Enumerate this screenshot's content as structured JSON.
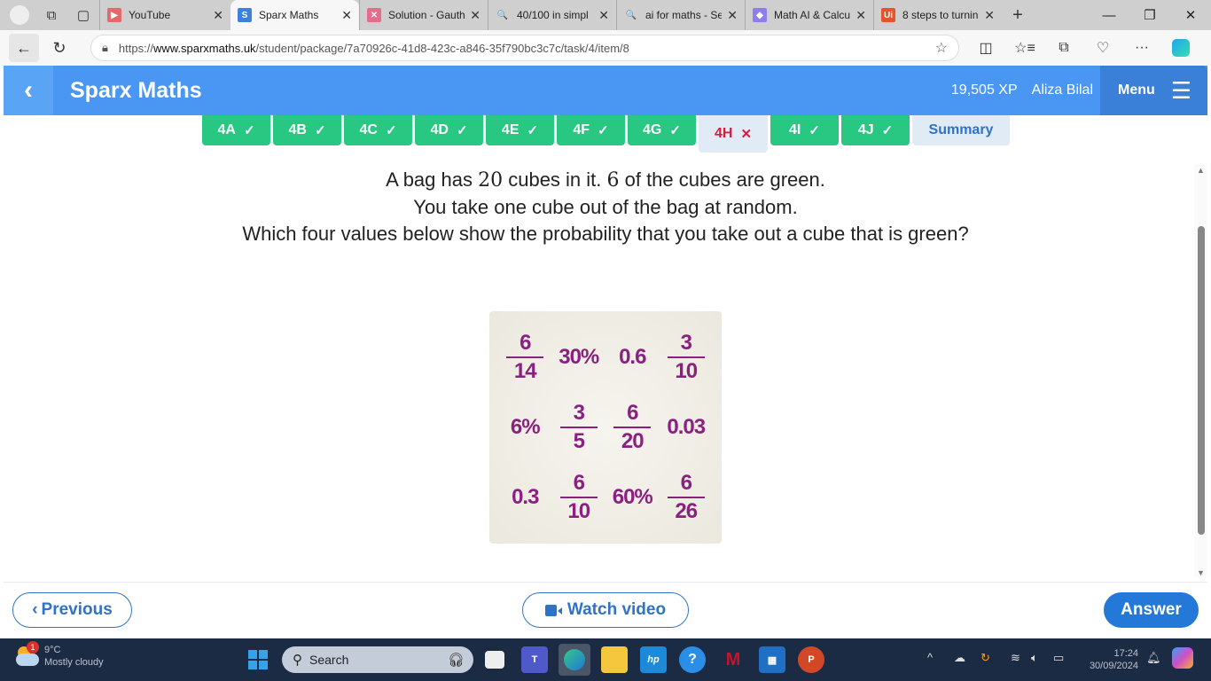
{
  "browser": {
    "tabs": [
      {
        "title": "YouTube",
        "icon": "youtube-icon",
        "color": "#e26a6a",
        "glyph": "▶"
      },
      {
        "title": "Sparx Maths",
        "icon": "sparx-icon",
        "color": "#3b82e0",
        "glyph": "S",
        "active": true
      },
      {
        "title": "Solution - Gauth",
        "icon": "gauth-icon",
        "color": "#e76b8a",
        "glyph": "✕"
      },
      {
        "title": "40/100 in simpl",
        "icon": "search-icon",
        "color": "transparent",
        "glyph": "🔍"
      },
      {
        "title": "ai for maths - Se",
        "icon": "search-icon",
        "color": "transparent",
        "glyph": "🔍"
      },
      {
        "title": "Math AI & Calcu",
        "icon": "mathai-icon",
        "color": "#8f7cf0",
        "glyph": "◆"
      },
      {
        "title": "8 steps to turnin",
        "icon": "uipath-icon",
        "color": "#e8542a",
        "glyph": "Ui"
      }
    ],
    "url_prefix": "https://",
    "url_domain": "www.sparxmaths.uk",
    "url_path": "/student/package/7a70926c-41d8-423c-a846-35f790bc3c7c/task/4/item/8"
  },
  "header": {
    "brand": "Sparx Maths",
    "xp": "19,505 XP",
    "user": "Aliza Bilal",
    "menu": "Menu"
  },
  "tasks": [
    {
      "label": "4A",
      "status": "✓"
    },
    {
      "label": "4B",
      "status": "✓"
    },
    {
      "label": "4C",
      "status": "✓"
    },
    {
      "label": "4D",
      "status": "✓"
    },
    {
      "label": "4E",
      "status": "✓"
    },
    {
      "label": "4F",
      "status": "✓"
    },
    {
      "label": "4G",
      "status": "✓"
    },
    {
      "label": "4H",
      "status": "✕"
    },
    {
      "label": "4I",
      "status": "✓"
    },
    {
      "label": "4J",
      "status": "✓"
    }
  ],
  "summary_label": "Summary",
  "question": {
    "l1a": "A bag has ",
    "n1": "20",
    "l1b": " cubes in it. ",
    "n2": "6",
    "l1c": " of the cubes are green.",
    "line2": "You take one cube out of the bag at random.",
    "line3": "Which four values below show the probability that you take out a cube that is green?"
  },
  "answers": [
    {
      "type": "frac",
      "num": "6",
      "den": "14"
    },
    {
      "type": "text",
      "value": "30%"
    },
    {
      "type": "text",
      "value": "0.6"
    },
    {
      "type": "frac",
      "num": "3",
      "den": "10"
    },
    {
      "type": "text",
      "value": "6%"
    },
    {
      "type": "frac",
      "num": "3",
      "den": "5"
    },
    {
      "type": "frac",
      "num": "6",
      "den": "20"
    },
    {
      "type": "text",
      "value": "0.03"
    },
    {
      "type": "text",
      "value": "0.3"
    },
    {
      "type": "frac",
      "num": "6",
      "den": "10"
    },
    {
      "type": "text",
      "value": "60%"
    },
    {
      "type": "frac",
      "num": "6",
      "den": "26"
    }
  ],
  "footer": {
    "previous": "Previous",
    "watch": "Watch video",
    "answer": "Answer"
  },
  "taskbar": {
    "temp": "9°C",
    "weather": "Mostly cloudy",
    "notif_count": "1",
    "search": "Search",
    "time": "17:24",
    "date": "30/09/2024"
  }
}
